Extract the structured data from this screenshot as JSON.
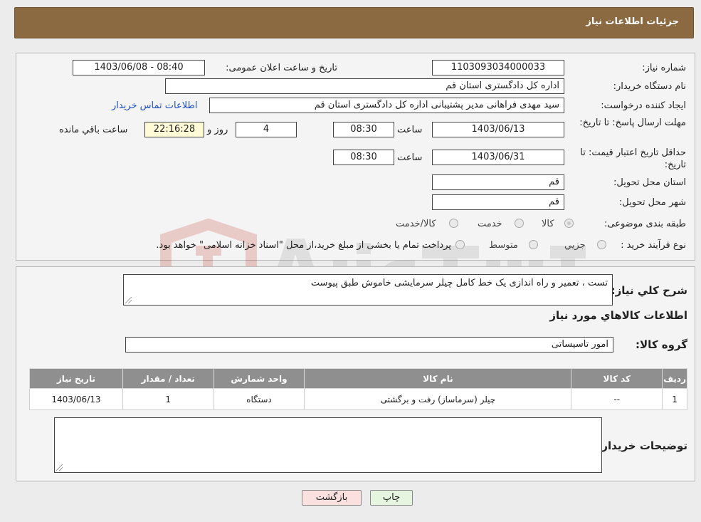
{
  "header": {
    "title": "جزئیات اطلاعات نیاز"
  },
  "form": {
    "need_number_label": "شماره نیاز:",
    "need_number": "1103093034000033",
    "announce_label": "تاریخ و ساعت اعلان عمومی:",
    "announce_value": "1403/06/08 - 08:40",
    "buyer_org_label": "نام دستگاه خریدار:",
    "buyer_org": "اداره کل دادگستری استان قم",
    "creator_label": "ایجاد کننده درخواست:",
    "creator": "سید مهدی فراهانی مدیر پشتیبانی اداره کل دادگستری استان قم",
    "contact_link": "اطلاعات تماس خریدار",
    "deadline_label": "مهلت ارسال پاسخ: تا تاریخ:",
    "deadline_date": "1403/06/13",
    "time_label": "ساعت",
    "deadline_time": "08:30",
    "days": "4",
    "days_label": "روز و",
    "remaining": "22:16:28",
    "remaining_label": "ساعت باقي مانده",
    "validity_label": "حداقل تاریخ اعتبار قیمت: تا تاریخ:",
    "validity_date": "1403/06/31",
    "validity_time": "08:30",
    "province_label": "استان محل تحویل:",
    "province": "قم",
    "city_label": "شهر محل تحویل:",
    "city": "قم",
    "category_label": "طبقه بندی موضوعی:",
    "category_options": [
      "کالا",
      "خدمت",
      "کالا/خدمت"
    ],
    "process_label": "نوع فرآیند خرید :",
    "process_options": [
      "جزیي",
      "متوسط"
    ],
    "process_note": "پرداخت تمام یا بخشی از مبلغ خرید،از محل \"اسناد خزانه اسلامی\" خواهد بود."
  },
  "details": {
    "description_label": "شرح کلي نياز:",
    "description": "تست ، تعمیر و راه اندازی یک خط کامل چیلر سرمایشی خاموش طبق پیوست",
    "goods_info_title": "اطلاعات کالاهاي مورد نياز",
    "goods_group_label": "گروه کالا:",
    "goods_group": "امور تاسیساتی",
    "table_headers": [
      "رديف",
      "کد کالا",
      "نام کالا",
      "واحد شمارش",
      "تعداد / مقدار",
      "تاریخ نیاز"
    ],
    "table_rows": [
      [
        "1",
        "--",
        "چیلر (سرماساز) رفت و برگشتی",
        "دستگاه",
        "1",
        "1403/06/13"
      ]
    ],
    "buyer_notes_label": "توضیحات خریدار:"
  },
  "buttons": {
    "print": "چاپ",
    "back": "بازگشت"
  }
}
